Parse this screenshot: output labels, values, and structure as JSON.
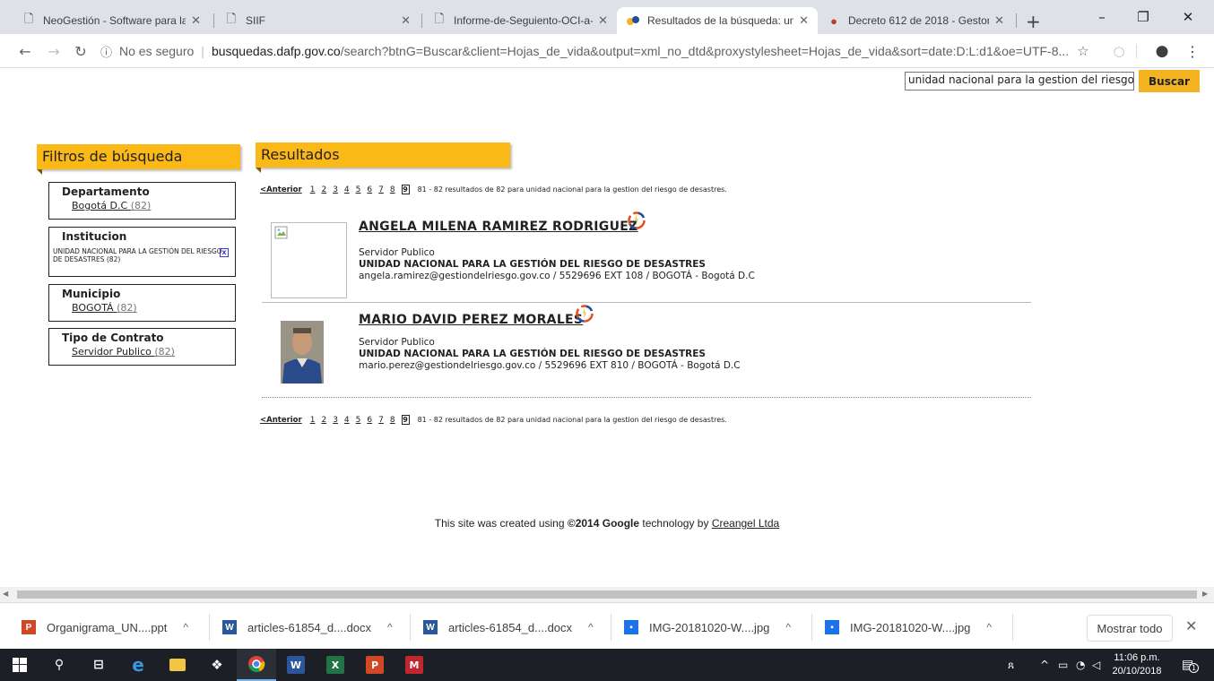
{
  "browser": {
    "tabs": [
      {
        "title": "NeoGestión - Software para la",
        "active": false
      },
      {
        "title": "SIIF",
        "active": false
      },
      {
        "title": "Informe-de-Seguiento-OCI-a-",
        "active": false
      },
      {
        "title": "Resultados de la búsqueda: un",
        "active": true
      },
      {
        "title": "Decreto 612 de 2018 - Gestor",
        "active": false
      }
    ],
    "new_tab": "+",
    "address": {
      "security": "No es seguro",
      "host": "busquedas.dafp.gov.co",
      "path": "/search?btnG=Buscar&client=Hojas_de_vida&output=xml_no_dtd&proxystylesheet=Hojas_de_vida&sort=date:D:L:d1&oe=UTF-8..."
    }
  },
  "search": {
    "query": "unidad nacional para la gestion del riesgo d",
    "button": "Buscar"
  },
  "filters": {
    "title": "Filtros de búsqueda",
    "groups": [
      {
        "title": "Departamento",
        "value": "Bogotá D.C",
        "count": "(82)"
      },
      {
        "title": "Institucion",
        "value": "UNIDAD NACIONAL PARA LA GESTIÓN DEL RIESGO DE DESASTRES (82)",
        "remove": "x"
      },
      {
        "title": "Municipio",
        "value": "BOGOTÁ",
        "count": "(82)"
      },
      {
        "title": "Tipo de Contrato",
        "value": "Servidor Publico",
        "count": "(82)"
      }
    ]
  },
  "results": {
    "title": "Resultados",
    "pager": {
      "prev": "<Anterior",
      "pages": [
        "1",
        "2",
        "3",
        "4",
        "5",
        "6",
        "7",
        "8"
      ],
      "current": "9",
      "stats": "81 - 82 resultados de 82 para unidad nacional para la gestion del riesgo de desastres."
    },
    "items": [
      {
        "name": "ANGELA MILENA RAMIREZ RODRIGUEZ",
        "type": "Servidor Publico",
        "entity": "UNIDAD NACIONAL PARA LA GESTIÓN DEL RIESGO DE DESASTRES",
        "contact": "angela.ramirez@gestiondelriesgo.gov.co  / 5529696 EXT 108  / BOGOTÁ - Bogotá D.C",
        "photo": "broken-image"
      },
      {
        "name": "MARIO DAVID PEREZ MORALES",
        "type": "Servidor Publico",
        "entity": "UNIDAD NACIONAL PARA LA GESTIÓN DEL RIESGO DE DESASTRES",
        "contact": "mario.perez@gestiondelriesgo.gov.co  / 5529696 EXT 810  / BOGOTÁ - Bogotá D.C",
        "photo": "person-photo"
      }
    ]
  },
  "footer": {
    "prefix": "This site was created using",
    "brand": "©2014 Google",
    "middle": "technology by",
    "link": "Creangel Ltda"
  },
  "downloads": {
    "items": [
      {
        "name": "Organigrama_UN....ppt",
        "icon": "ppt-icon",
        "color": "#d24726"
      },
      {
        "name": "articles-61854_d....docx",
        "icon": "docx-icon",
        "color": "#2b579a"
      },
      {
        "name": "articles-61854_d....docx",
        "icon": "docx-icon",
        "color": "#2b579a"
      },
      {
        "name": "IMG-20181020-W....jpg",
        "icon": "image-file-icon",
        "color": "#1a73e8"
      },
      {
        "name": "IMG-20181020-W....jpg",
        "icon": "image-file-icon",
        "color": "#1a73e8"
      }
    ],
    "show_all": "Mostrar todo"
  },
  "taskbar": {
    "time": "11:06 p.m.",
    "date": "20/10/2018",
    "notification_count": "1"
  },
  "colors": {
    "accent": "#fbb917",
    "button": "#f4b322"
  }
}
